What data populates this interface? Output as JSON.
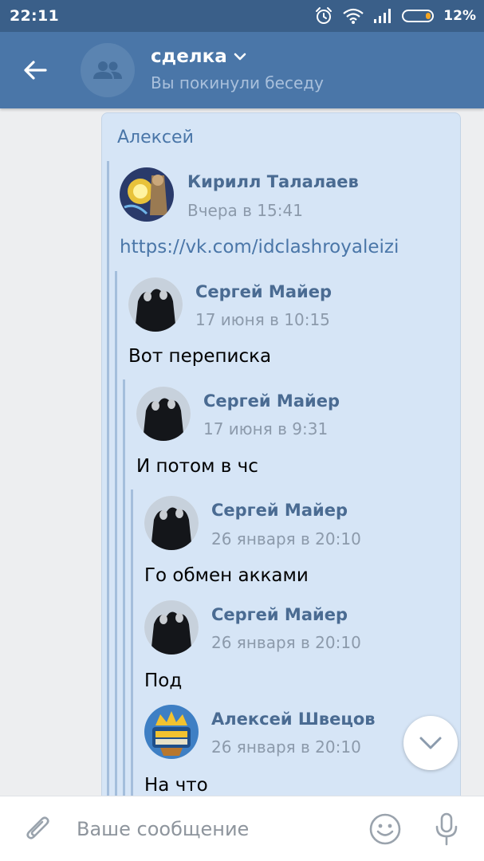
{
  "status_bar": {
    "time": "22:11",
    "battery_percent": "12%",
    "battery_level": 0.12,
    "icons": [
      "alarm-icon",
      "wifi-icon",
      "signal-icon",
      "battery-icon"
    ]
  },
  "header": {
    "title": "сделка",
    "subtitle": "Вы покинули беседу",
    "icons": [
      "back-arrow-icon",
      "group-icon",
      "chevron-down-icon"
    ]
  },
  "message": {
    "sender": "Алексей",
    "forwarded": [
      {
        "author": "Кирилл Талалаев",
        "date": "Вчера в 15:41",
        "text": "https://vk.com/idclashroyaleizi",
        "is_link": true,
        "level": 1
      },
      {
        "author": "Сергей Майер",
        "date": "17 июня в 10:15",
        "text": "Вот переписка",
        "level": 2
      },
      {
        "author": "Сергей Майер",
        "date": "17 июня в 9:31",
        "text": "И потом в чс",
        "level": 3
      },
      {
        "author": "Сергей Майер",
        "date": "26 января в 20:10",
        "text": "Го обмен акками",
        "level": 4
      },
      {
        "author": "Сергей Майер",
        "date": "26 января в 20:10",
        "text": "Под",
        "level": 4
      },
      {
        "author": "Алексей Швецов",
        "date": "26 января в 20:10",
        "text": "На что",
        "level": 4
      }
    ]
  },
  "composer": {
    "placeholder": "Ваше сообщение",
    "icons": [
      "paperclip-icon",
      "emoji-icon",
      "microphone-icon"
    ]
  },
  "colors": {
    "status_bar": "#3a5f89",
    "header": "#4a76a8",
    "bubble": "#d6e5f6",
    "link": "#4a76a8",
    "author": "#4a6b92",
    "date": "#8c9aab"
  }
}
